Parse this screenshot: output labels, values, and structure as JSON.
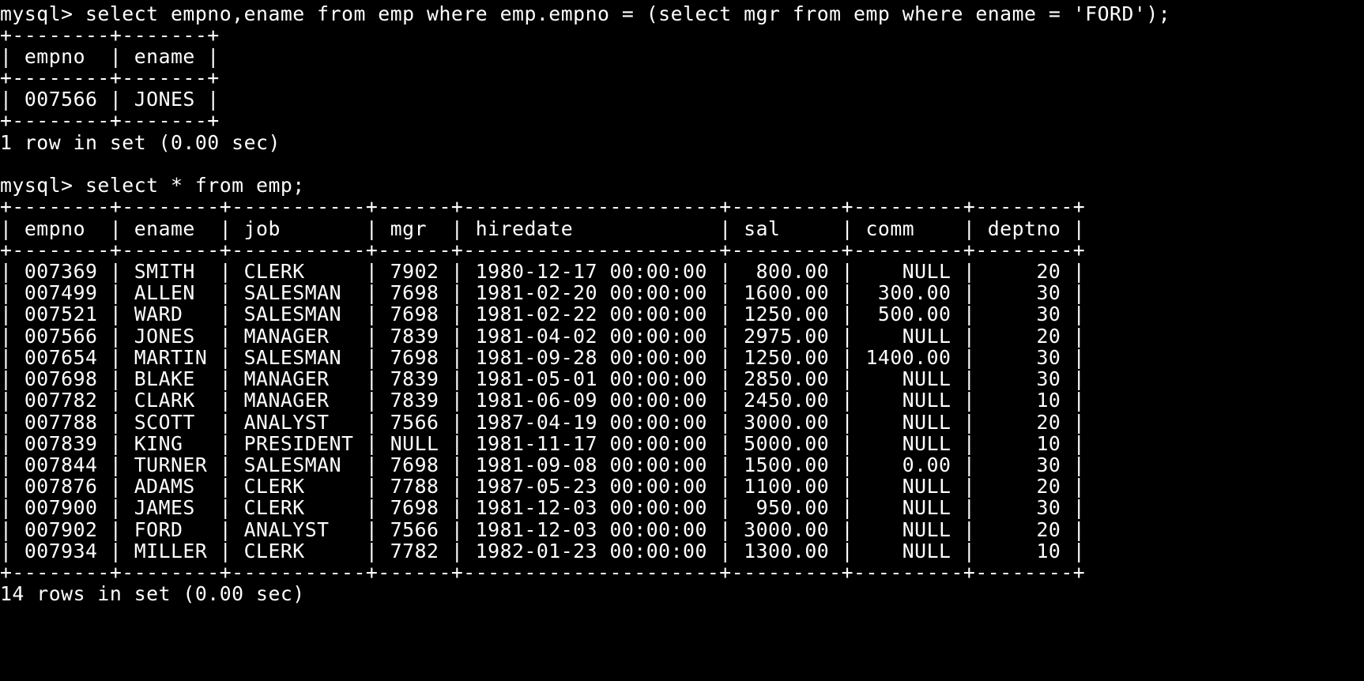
{
  "terminal": {
    "lines": [
      "mysql> select empno,ename from emp where emp.empno = (select mgr from emp where ename = 'FORD');",
      "+--------+-------+",
      "| empno  | ename |",
      "+--------+-------+",
      "| 007566 | JONES |",
      "+--------+-------+",
      "1 row in set (0.00 sec)",
      "",
      "mysql> select * from emp;",
      "+--------+--------+-----------+------+---------------------+---------+---------+--------+",
      "| empno  | ename  | job       | mgr  | hiredate            | sal     | comm    | deptno |",
      "+--------+--------+-----------+------+---------------------+---------+---------+--------+",
      "| 007369 | SMITH  | CLERK     | 7902 | 1980-12-17 00:00:00 |  800.00 |    NULL |     20 |",
      "| 007499 | ALLEN  | SALESMAN  | 7698 | 1981-02-20 00:00:00 | 1600.00 |  300.00 |     30 |",
      "| 007521 | WARD   | SALESMAN  | 7698 | 1981-02-22 00:00:00 | 1250.00 |  500.00 |     30 |",
      "| 007566 | JONES  | MANAGER   | 7839 | 1981-04-02 00:00:00 | 2975.00 |    NULL |     20 |",
      "| 007654 | MARTIN | SALESMAN  | 7698 | 1981-09-28 00:00:00 | 1250.00 | 1400.00 |     30 |",
      "| 007698 | BLAKE  | MANAGER   | 7839 | 1981-05-01 00:00:00 | 2850.00 |    NULL |     30 |",
      "| 007782 | CLARK  | MANAGER   | 7839 | 1981-06-09 00:00:00 | 2450.00 |    NULL |     10 |",
      "| 007788 | SCOTT  | ANALYST   | 7566 | 1987-04-19 00:00:00 | 3000.00 |    NULL |     20 |",
      "| 007839 | KING   | PRESIDENT | NULL | 1981-11-17 00:00:00 | 5000.00 |    NULL |     10 |",
      "| 007844 | TURNER | SALESMAN  | 7698 | 1981-09-08 00:00:00 | 1500.00 |    0.00 |     30 |",
      "| 007876 | ADAMS  | CLERK     | 7788 | 1987-05-23 00:00:00 | 1100.00 |    NULL |     20 |",
      "| 007900 | JAMES  | CLERK     | 7698 | 1981-12-03 00:00:00 |  950.00 |    NULL |     30 |",
      "| 007902 | FORD   | ANALYST   | 7566 | 1981-12-03 00:00:00 | 3000.00 |    NULL |     20 |",
      "| 007934 | MILLER | CLERK     | 7782 | 1982-01-23 00:00:00 | 1300.00 |    NULL |     10 |",
      "+--------+--------+-----------+------+---------------------+---------+---------+--------+",
      "14 rows in set (0.00 sec)"
    ]
  },
  "colors": {
    "background": "#000000",
    "text": "#ffffff"
  }
}
